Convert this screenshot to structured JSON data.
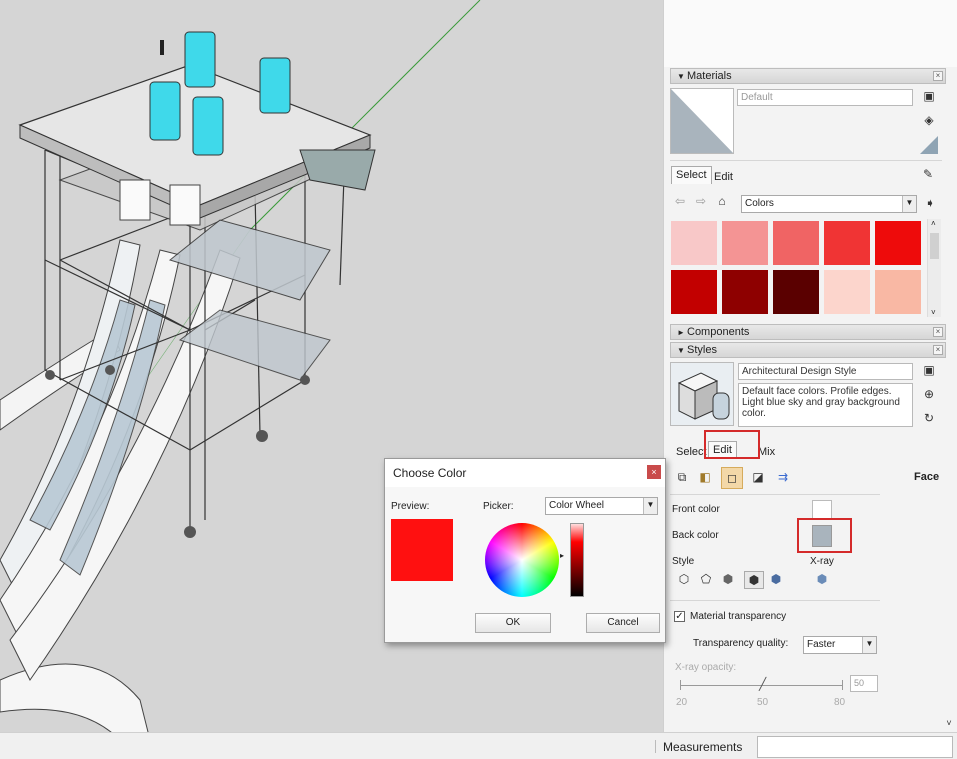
{
  "tray": {
    "materials": {
      "title": "Materials",
      "name_value": "Default",
      "tabs": [
        "Select",
        "Edit"
      ],
      "library": "Colors",
      "swatches": [
        "#f8c8c8",
        "#f49494",
        "#f06464",
        "#f03434",
        "#ee0b0b",
        "#c20000",
        "#8e0000",
        "#5a0000",
        "#fcd5cc",
        "#f9b8a4"
      ]
    },
    "components": {
      "title": "Components"
    },
    "styles": {
      "title": "Styles",
      "name_value": "Architectural Design Style",
      "description": "Default face colors. Profile edges. Light blue sky and gray background color.",
      "tabs": [
        "Select",
        "Edit",
        "Mix"
      ],
      "section": "Face",
      "front_color_label": "Front color",
      "back_color_label": "Back color",
      "front_color": "#ffffff",
      "back_color": "#a9b4bd",
      "style_label": "Style",
      "xray_label": "X-ray",
      "material_transparency_label": "Material transparency",
      "material_transparency_checked": true,
      "transparency_quality_label": "Transparency quality:",
      "transparency_quality_value": "Faster",
      "xray_opacity_label": "X-ray opacity:",
      "xray_opacity_value": "50",
      "slider_ticks": [
        "20",
        "50",
        "80"
      ]
    }
  },
  "dialog": {
    "title": "Choose Color",
    "preview_label": "Preview:",
    "picker_label": "Picker:",
    "picker_value": "Color Wheel",
    "preview_color": "#ff1010",
    "ok_label": "OK",
    "cancel_label": "Cancel"
  },
  "status": {
    "measurements_label": "Measurements"
  }
}
